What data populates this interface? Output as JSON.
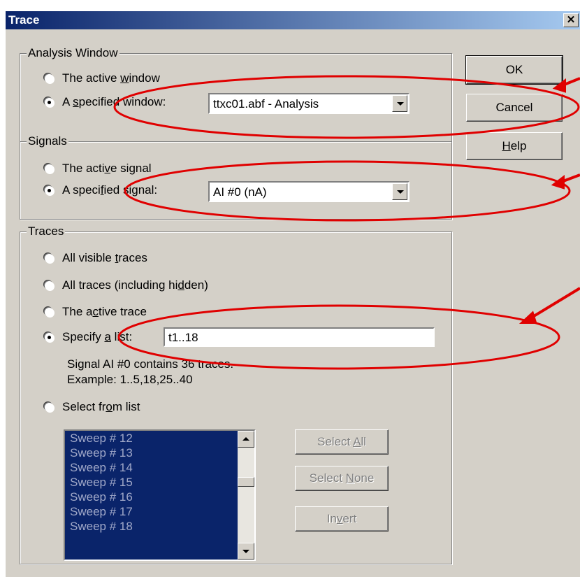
{
  "window": {
    "title": "Trace",
    "close_glyph": "✕"
  },
  "analysis_window": {
    "group_label": "Analysis Window",
    "opt_active": "The active window",
    "opt_specified": "A specified window:",
    "selected_value": "ttxc01.abf - Analysis"
  },
  "signals": {
    "group_label": "Signals",
    "opt_active": "The active signal",
    "opt_specified": "A specified signal:",
    "selected_value": "AI #0 (nA)"
  },
  "traces": {
    "group_label": "Traces",
    "opt_visible": "All visible traces",
    "opt_all": "All traces (including hidden)",
    "opt_active": "The active trace",
    "opt_specify": "Specify a list:",
    "list_value": "t1..18",
    "info_line1": "Signal AI #0 contains 36 traces.",
    "info_line2": "Example: 1..5,18,25..40",
    "opt_select": "Select from list",
    "list_items": [
      "Sweep # 12",
      "Sweep # 13",
      "Sweep # 14",
      "Sweep # 15",
      "Sweep # 16",
      "Sweep # 17",
      "Sweep # 18"
    ],
    "btn_select_all": "Select All",
    "btn_select_none": "Select None",
    "btn_invert": "Invert"
  },
  "buttons": {
    "ok": "OK",
    "cancel": "Cancel",
    "help": "Help"
  },
  "annotation_color": "#e00000",
  "selection_color": "#0a246a"
}
